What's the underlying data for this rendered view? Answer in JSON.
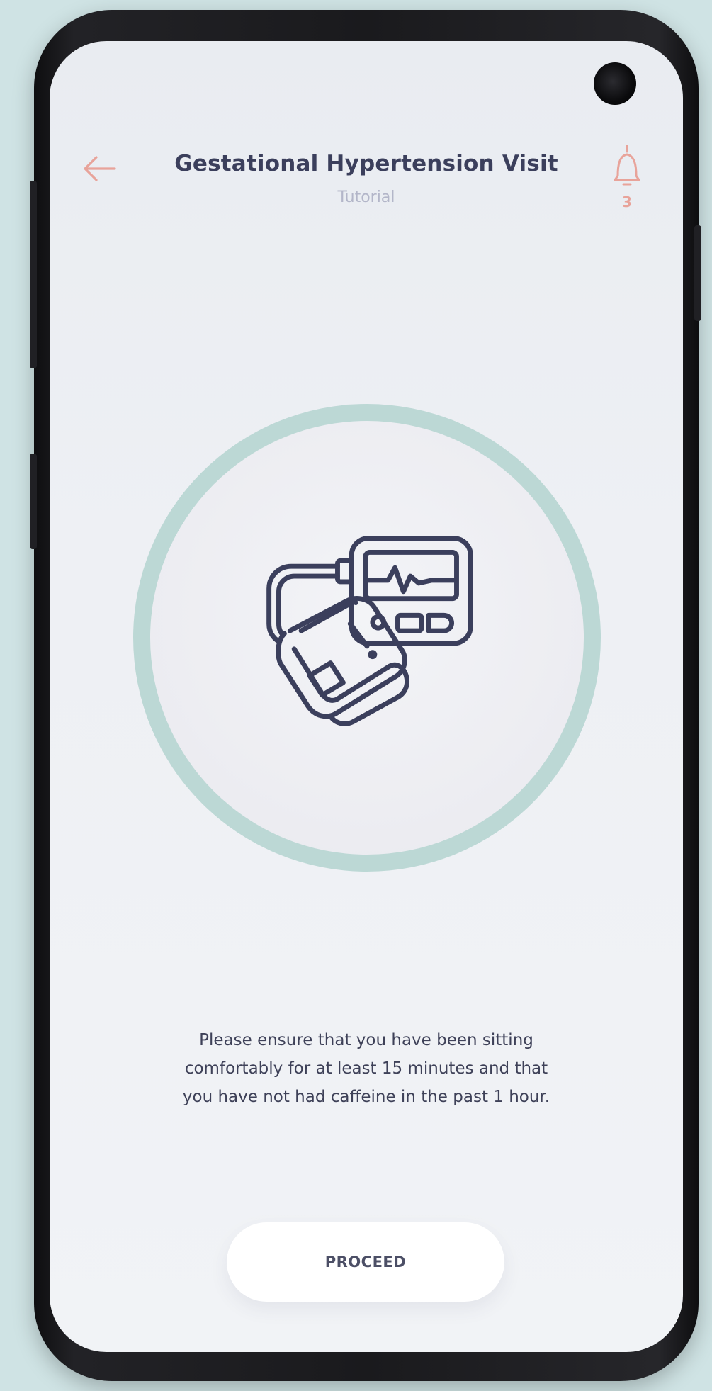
{
  "header": {
    "title": "Gestational Hypertension Visit",
    "subtitle": "Tutorial",
    "back_icon": "arrow-left-icon",
    "notification_icon": "bell-icon",
    "notification_count": "3"
  },
  "illustration": {
    "icon": "blood-pressure-monitor-icon"
  },
  "instructions": {
    "message": "Please ensure that you have been sitting\ncomfortably for at least 15 minutes and that\nyou have not had caffeine in the past 1 hour."
  },
  "actions": {
    "proceed_label": "PROCEED"
  },
  "colors": {
    "accent": "#e8a39a",
    "title": "#3b3f5c",
    "subtitle": "#b3b6c9",
    "ring": "#bcd8d5",
    "icon_stroke": "#3b3f5c",
    "background": "#cfe3e4"
  }
}
